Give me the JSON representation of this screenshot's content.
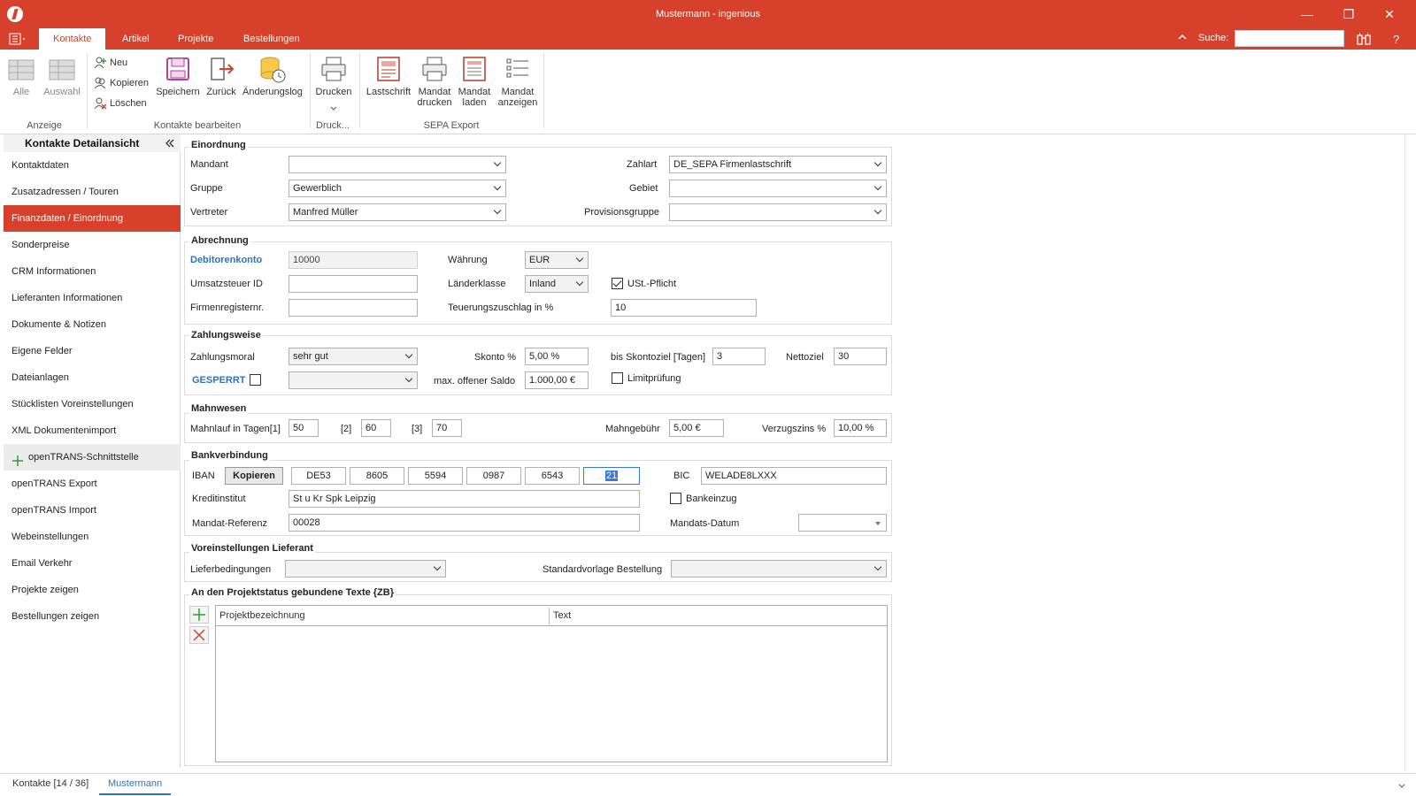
{
  "window": {
    "title": "Mustermann - ingenious",
    "minimize": "—",
    "restore": "❐",
    "close": "✕"
  },
  "tabs": [
    {
      "label": "Kontakte"
    },
    {
      "label": "Artikel"
    },
    {
      "label": "Projekte"
    },
    {
      "label": "Bestellungen"
    }
  ],
  "search": {
    "label": "Suche:",
    "value": "",
    "help": "?"
  },
  "ribbon": {
    "anzeige": {
      "group": "Anzeige",
      "alle": "Alle",
      "auswahl": "Auswahl"
    },
    "bearbeiten": {
      "group": "Kontakte bearbeiten",
      "neu": "Neu",
      "kopieren": "Kopieren",
      "loeschen": "Löschen",
      "speichern": "Speichern",
      "zurueck": "Zurück",
      "aenderungslog": "Änderungslog"
    },
    "druck": {
      "group": "Druck...",
      "drucken": "Drucken"
    },
    "sepa": {
      "group": "SEPA Export",
      "lastschrift": "Lastschrift",
      "mandat_drucken_1": "Mandat",
      "mandat_drucken_2": "drucken",
      "mandat_laden_1": "Mandat",
      "mandat_laden_2": "laden",
      "mandat_anzeigen_1": "Mandat",
      "mandat_anzeigen_2": "anzeigen"
    }
  },
  "nav": {
    "title": "Kontakte Detailansicht",
    "items": [
      {
        "label": "Kontaktdaten"
      },
      {
        "label": "Zusatzadressen / Touren"
      },
      {
        "label": "Finanzdaten / Einordnung"
      },
      {
        "label": "Sonderpreise"
      },
      {
        "label": "CRM Informationen"
      },
      {
        "label": "Lieferanten Informationen"
      },
      {
        "label": "Dokumente & Notizen"
      },
      {
        "label": "Eigene Felder"
      },
      {
        "label": "Dateianlagen"
      },
      {
        "label": "Stücklisten Voreinstellungen"
      },
      {
        "label": "XML Dokumentenimport"
      },
      {
        "label": "openTRANS-Schnittstelle"
      },
      {
        "label": "openTRANS Export"
      },
      {
        "label": "openTRANS Import"
      },
      {
        "label": "Webeinstellungen"
      },
      {
        "label": "Email Verkehr"
      },
      {
        "label": "Projekte zeigen"
      },
      {
        "label": "Bestellungen zeigen"
      }
    ]
  },
  "einordnung": {
    "title": "Einordnung",
    "mandant_label": "Mandant",
    "mandant_value": "",
    "gruppe_label": "Gruppe",
    "gruppe_value": "Gewerblich",
    "vertreter_label": "Vertreter",
    "vertreter_value": "Manfred Müller",
    "zahlart_label": "Zahlart",
    "zahlart_value": "DE_SEPA Firmenlastschrift",
    "gebiet_label": "Gebiet",
    "gebiet_value": "",
    "provision_label": "Provisionsgruppe",
    "provision_value": ""
  },
  "abrechnung": {
    "title": "Abrechnung",
    "debitor_label": "Debitorenkonto",
    "debitor_value": "10000",
    "ust_label": "Umsatzsteuer ID",
    "ust_value": "",
    "firmenreg_label": "Firmenregisternr.",
    "firmenreg_value": "",
    "waehrung_label": "Währung",
    "waehrung_value": "EUR",
    "laenderklasse_label": "Länderklasse",
    "laenderklasse_value": "Inland",
    "ustpflicht_label": "USt.-Pflicht",
    "ustpflicht_checked": true,
    "teuerung_label": "Teuerungszuschlag in %",
    "teuerung_value": "10"
  },
  "zahlungsweise": {
    "title": "Zahlungsweise",
    "moral_label": "Zahlungsmoral",
    "moral_value": "sehr gut",
    "gesperrt_label": "GESPERRT",
    "gesperrt_value": "",
    "skonto_label": "Skonto %",
    "skonto_value": "5,00 %",
    "saldo_label": "max. offener Saldo",
    "saldo_value": "1.000,00 €",
    "skontoziel_label": "bis Skontoziel [Tagen]",
    "skontoziel_value": "3",
    "limit_label": "Limitprüfung",
    "nettoziel_label": "Nettoziel",
    "nettoziel_value": "30"
  },
  "mahnwesen": {
    "title": "Mahnwesen",
    "lauf_label": "Mahnlauf in Tagen[1]",
    "lauf1": "50",
    "l2_label": "[2]",
    "lauf2": "60",
    "l3_label": "[3]",
    "lauf3": "70",
    "gebuehr_label": "Mahngebühr",
    "gebuehr_value": "5,00 €",
    "zins_label": "Verzugszins %",
    "zins_value": "10,00 %"
  },
  "bank": {
    "title": "Bankverbindung",
    "iban_label": "IBAN",
    "kopieren": "Kopieren",
    "iban_parts": [
      "DE53",
      "8605",
      "5594",
      "0987",
      "6543",
      "21"
    ],
    "bic_label": "BIC",
    "bic_value": "WELADE8LXXX",
    "institut_label": "Kreditinstitut",
    "institut_value": "St u Kr Spk Leipzig",
    "bankeinzug_label": "Bankeinzug",
    "mandat_label": "Mandat-Referenz",
    "mandat_value": "00028",
    "mdatum_label": "Mandats-Datum",
    "mdatum_value": ""
  },
  "lieferant": {
    "title": "Voreinstellungen Lieferant",
    "liefer_label": "Lieferbedingungen",
    "liefer_value": "",
    "vorlage_label": "Standardvorlage Bestellung",
    "vorlage_value": ""
  },
  "projekttexte": {
    "title": "An den Projektstatus gebundene Texte {ZB}",
    "col1": "Projektbezeichnung",
    "col2": "Text"
  },
  "bottom": {
    "tab1": "Kontakte [14 / 36]",
    "tab2": "Mustermann"
  },
  "colors": {
    "accent": "#d7412b",
    "link": "#2e75b6"
  }
}
